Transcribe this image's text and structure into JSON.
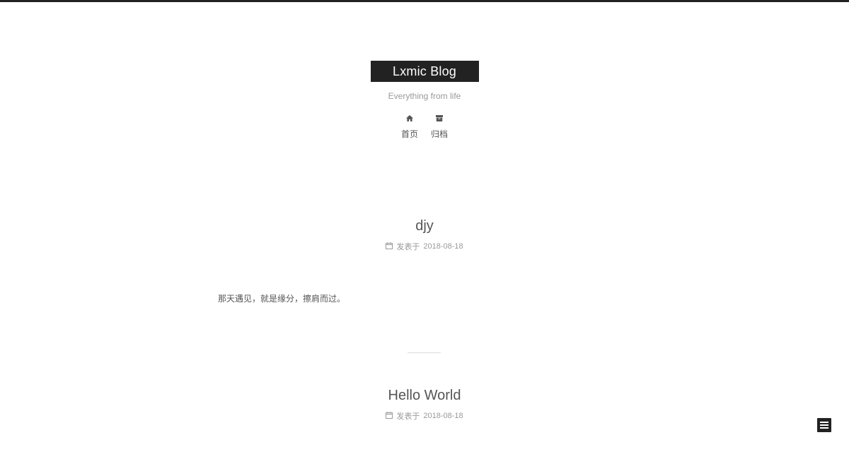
{
  "site": {
    "title": "Lxmic Blog",
    "subtitle": "Everything from life"
  },
  "menu": {
    "items": [
      {
        "label": "首页",
        "icon": "home-icon"
      },
      {
        "label": "归档",
        "icon": "archive-icon"
      }
    ]
  },
  "posts": [
    {
      "title": "djy",
      "meta_label": "发表于",
      "date": "2018-08-18",
      "excerpt": "那天遇见，就是缘分，擦肩而过。"
    },
    {
      "title": "Hello World",
      "meta_label": "发表于",
      "date": "2018-08-18"
    }
  ],
  "sidebar_toggle": {
    "icon": "menu-icon"
  },
  "colors": {
    "brand_bg": "#222222",
    "text": "#555555",
    "muted": "#999999"
  }
}
